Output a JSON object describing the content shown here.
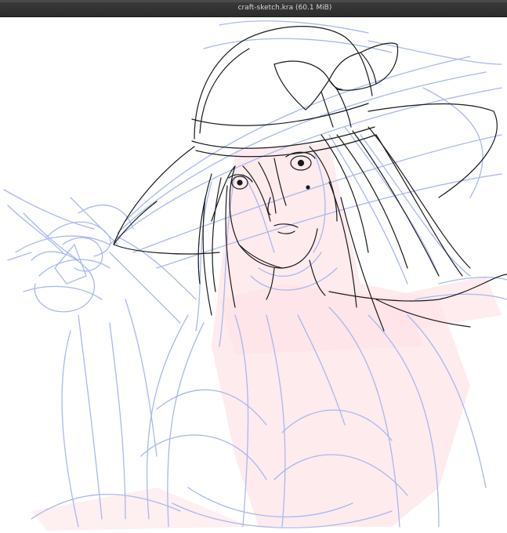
{
  "window": {
    "title": "craft-sketch.kra (60.1 MiB)"
  },
  "colors": {
    "titlebar": "#333333",
    "sketch_blue": "#a9b8ee",
    "color_pink": "#fde4e8",
    "lineart": "#1a1a1a"
  },
  "canvas": {
    "content": "lineart-illustration",
    "layers": [
      "sketch-layer",
      "color-layer",
      "lineart-layer"
    ]
  }
}
